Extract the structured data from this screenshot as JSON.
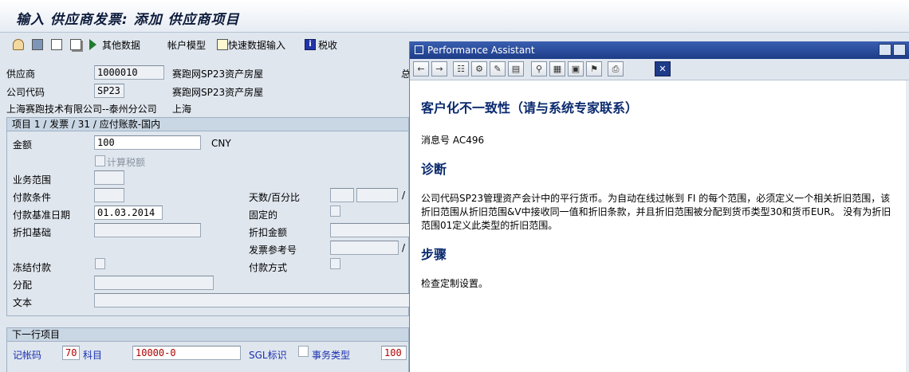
{
  "window": {
    "title": "输入 供应商发票: 添加 供应商项目"
  },
  "toolbar": {
    "other_data": "其他数据",
    "account_model": "帐户模型",
    "fast_entry": "快速数据输入",
    "tax": "税收"
  },
  "header": {
    "vendor_label": "供应商",
    "vendor_value": "1000010",
    "vendor_name": "赛跑网SP23资产房屋",
    "company_code_label": "公司代码",
    "company_code_value": "SP23",
    "company_code_name": "赛跑网SP23资产房屋",
    "vendor_address": "上海赛跑技术有限公司--泰州分公司",
    "vendor_city": "上海",
    "cut_label": "总"
  },
  "item_section": {
    "header": "项目 1 / 发票 / 31 / 应付账款-国内",
    "amount_label": "金额",
    "amount_value": "100",
    "currency": "CNY",
    "calc_tax_label": "计算税额",
    "business_area_label": "业务范围",
    "payment_terms_label": "付款条件",
    "days_pct_label": "天数/百分比",
    "baseline_date_label": "付款基准日期",
    "baseline_date_value": "01.03.2014",
    "fixed_label": "固定的",
    "discount_base_label": "折扣基础",
    "discount_amount_label": "折扣金额",
    "invoice_ref_label": "发票参考号",
    "payment_block_label": "冻结付款",
    "payment_method_label": "付款方式",
    "assignment_label": "分配",
    "text_label": "文本",
    "slash": "/"
  },
  "next_item": {
    "header": "下一行项目",
    "posting_key_label": "记帐码",
    "posting_key_value": "70",
    "account_label": "科目",
    "account_value": "10000-0",
    "sgl_label": "SGL标识",
    "transaction_type_label": "事务类型",
    "transaction_type_value": "100"
  },
  "performance_assistant": {
    "title": "Performance Assistant",
    "heading": "客户化不一致性（请与系统专家联系）",
    "message_no": "消息号  AC496",
    "diagnosis_heading": "诊断",
    "diagnosis_text": "公司代码SP23管理资产会计中的平行货币。为自动在线过帐到  FI 的每个范围，必须定义一个相关折旧范围，该折旧范围从折旧范围&V中接收同一值和折旧条款，并且折旧范围被分配到货币类型30和货币EUR。  没有为折旧范围01定义此类型的折旧范围。",
    "steps_heading": "步骤",
    "steps_text": "检查定制设置。"
  },
  "colors": {
    "title_text": "#0c1a3a",
    "accent_blue": "#1a31b0",
    "popup_title": "#1d3c88",
    "heading_text": "#0a2a6e",
    "value_red": "#b00000"
  }
}
